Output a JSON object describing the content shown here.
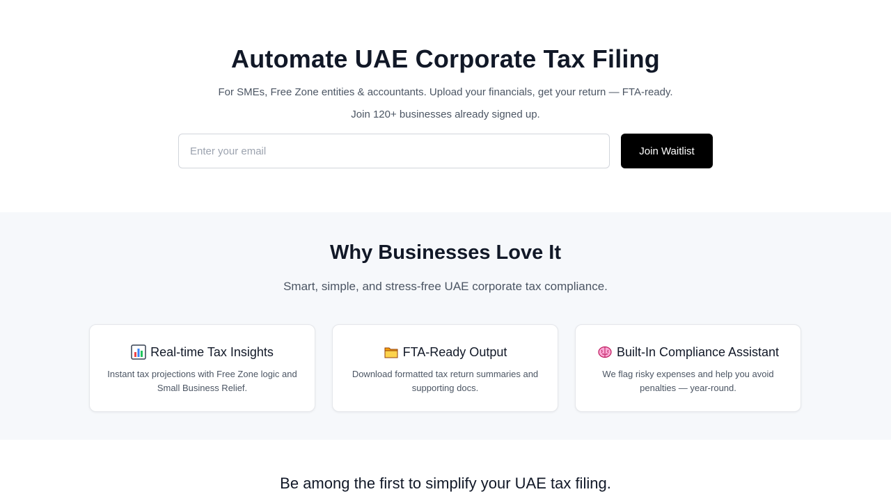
{
  "hero": {
    "title": "Automate UAE Corporate Tax Filing",
    "subtitle": "For SMEs, Free Zone entities & accountants. Upload your financials, get your return — FTA-ready.",
    "signup_count": "Join 120+ businesses already signed up.",
    "email_placeholder": "Enter your email",
    "email_value": "",
    "join_label": "Join Waitlist"
  },
  "features": {
    "title": "Why Businesses Love It",
    "subtitle": "Smart, simple, and stress-free UAE corporate tax compliance.",
    "cards": [
      {
        "icon": "bar-chart-icon",
        "title": "Real-time Tax Insights",
        "desc": "Instant tax projections with Free Zone logic and Small Business Relief."
      },
      {
        "icon": "folder-icon",
        "title": "FTA-Ready Output",
        "desc": "Download formatted tax return summaries and supporting docs."
      },
      {
        "icon": "brain-icon",
        "title": "Built-In Compliance Assistant",
        "desc": "We flag risky expenses and help you avoid penalties — year-round."
      }
    ]
  },
  "cta": {
    "title": "Be among the first to simplify your UAE tax filing."
  },
  "colors": {
    "button_bg": "#000000",
    "section_bg": "#f6f8fb",
    "text_dark": "#111827",
    "text_muted": "#4b5563"
  }
}
